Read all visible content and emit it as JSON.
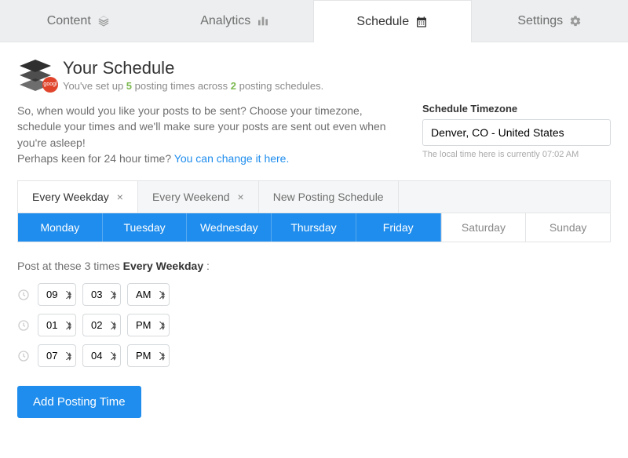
{
  "nav": {
    "content": "Content",
    "analytics": "Analytics",
    "schedule": "Schedule",
    "settings": "Settings"
  },
  "header": {
    "title": "Your Schedule",
    "sub_prefix": "You've set up ",
    "times_count": "5",
    "sub_mid": " posting times across ",
    "schedules_count": "2",
    "sub_suffix": " posting schedules.",
    "badge_text": "googl"
  },
  "desc": {
    "line1": "So, when would you like your posts to be sent? Choose your timezone, schedule your times and we'll make sure your posts are sent out even when you're asleep!",
    "line2_prefix": "Perhaps keen for 24 hour time? ",
    "line2_link": "You can change it here."
  },
  "timezone": {
    "label": "Schedule Timezone",
    "value": "Denver, CO - United States",
    "hint": "The local time here is currently 07:02 AM"
  },
  "sched_tabs": {
    "weekday": "Every Weekday",
    "weekend": "Every Weekend",
    "new": "New Posting Schedule"
  },
  "days": {
    "mon": "Monday",
    "tue": "Tuesday",
    "wed": "Wednesday",
    "thu": "Thursday",
    "fri": "Friday",
    "sat": "Saturday",
    "sun": "Sunday"
  },
  "times": {
    "label_prefix": "Post at these 3 times ",
    "label_bold": "Every Weekday",
    "label_suffix": " :",
    "rows": [
      {
        "hour": "09",
        "minute": "03",
        "ampm": "AM"
      },
      {
        "hour": "01",
        "minute": "02",
        "ampm": "PM"
      },
      {
        "hour": "07",
        "minute": "04",
        "ampm": "PM"
      }
    ]
  },
  "btn_add": "Add Posting Time"
}
